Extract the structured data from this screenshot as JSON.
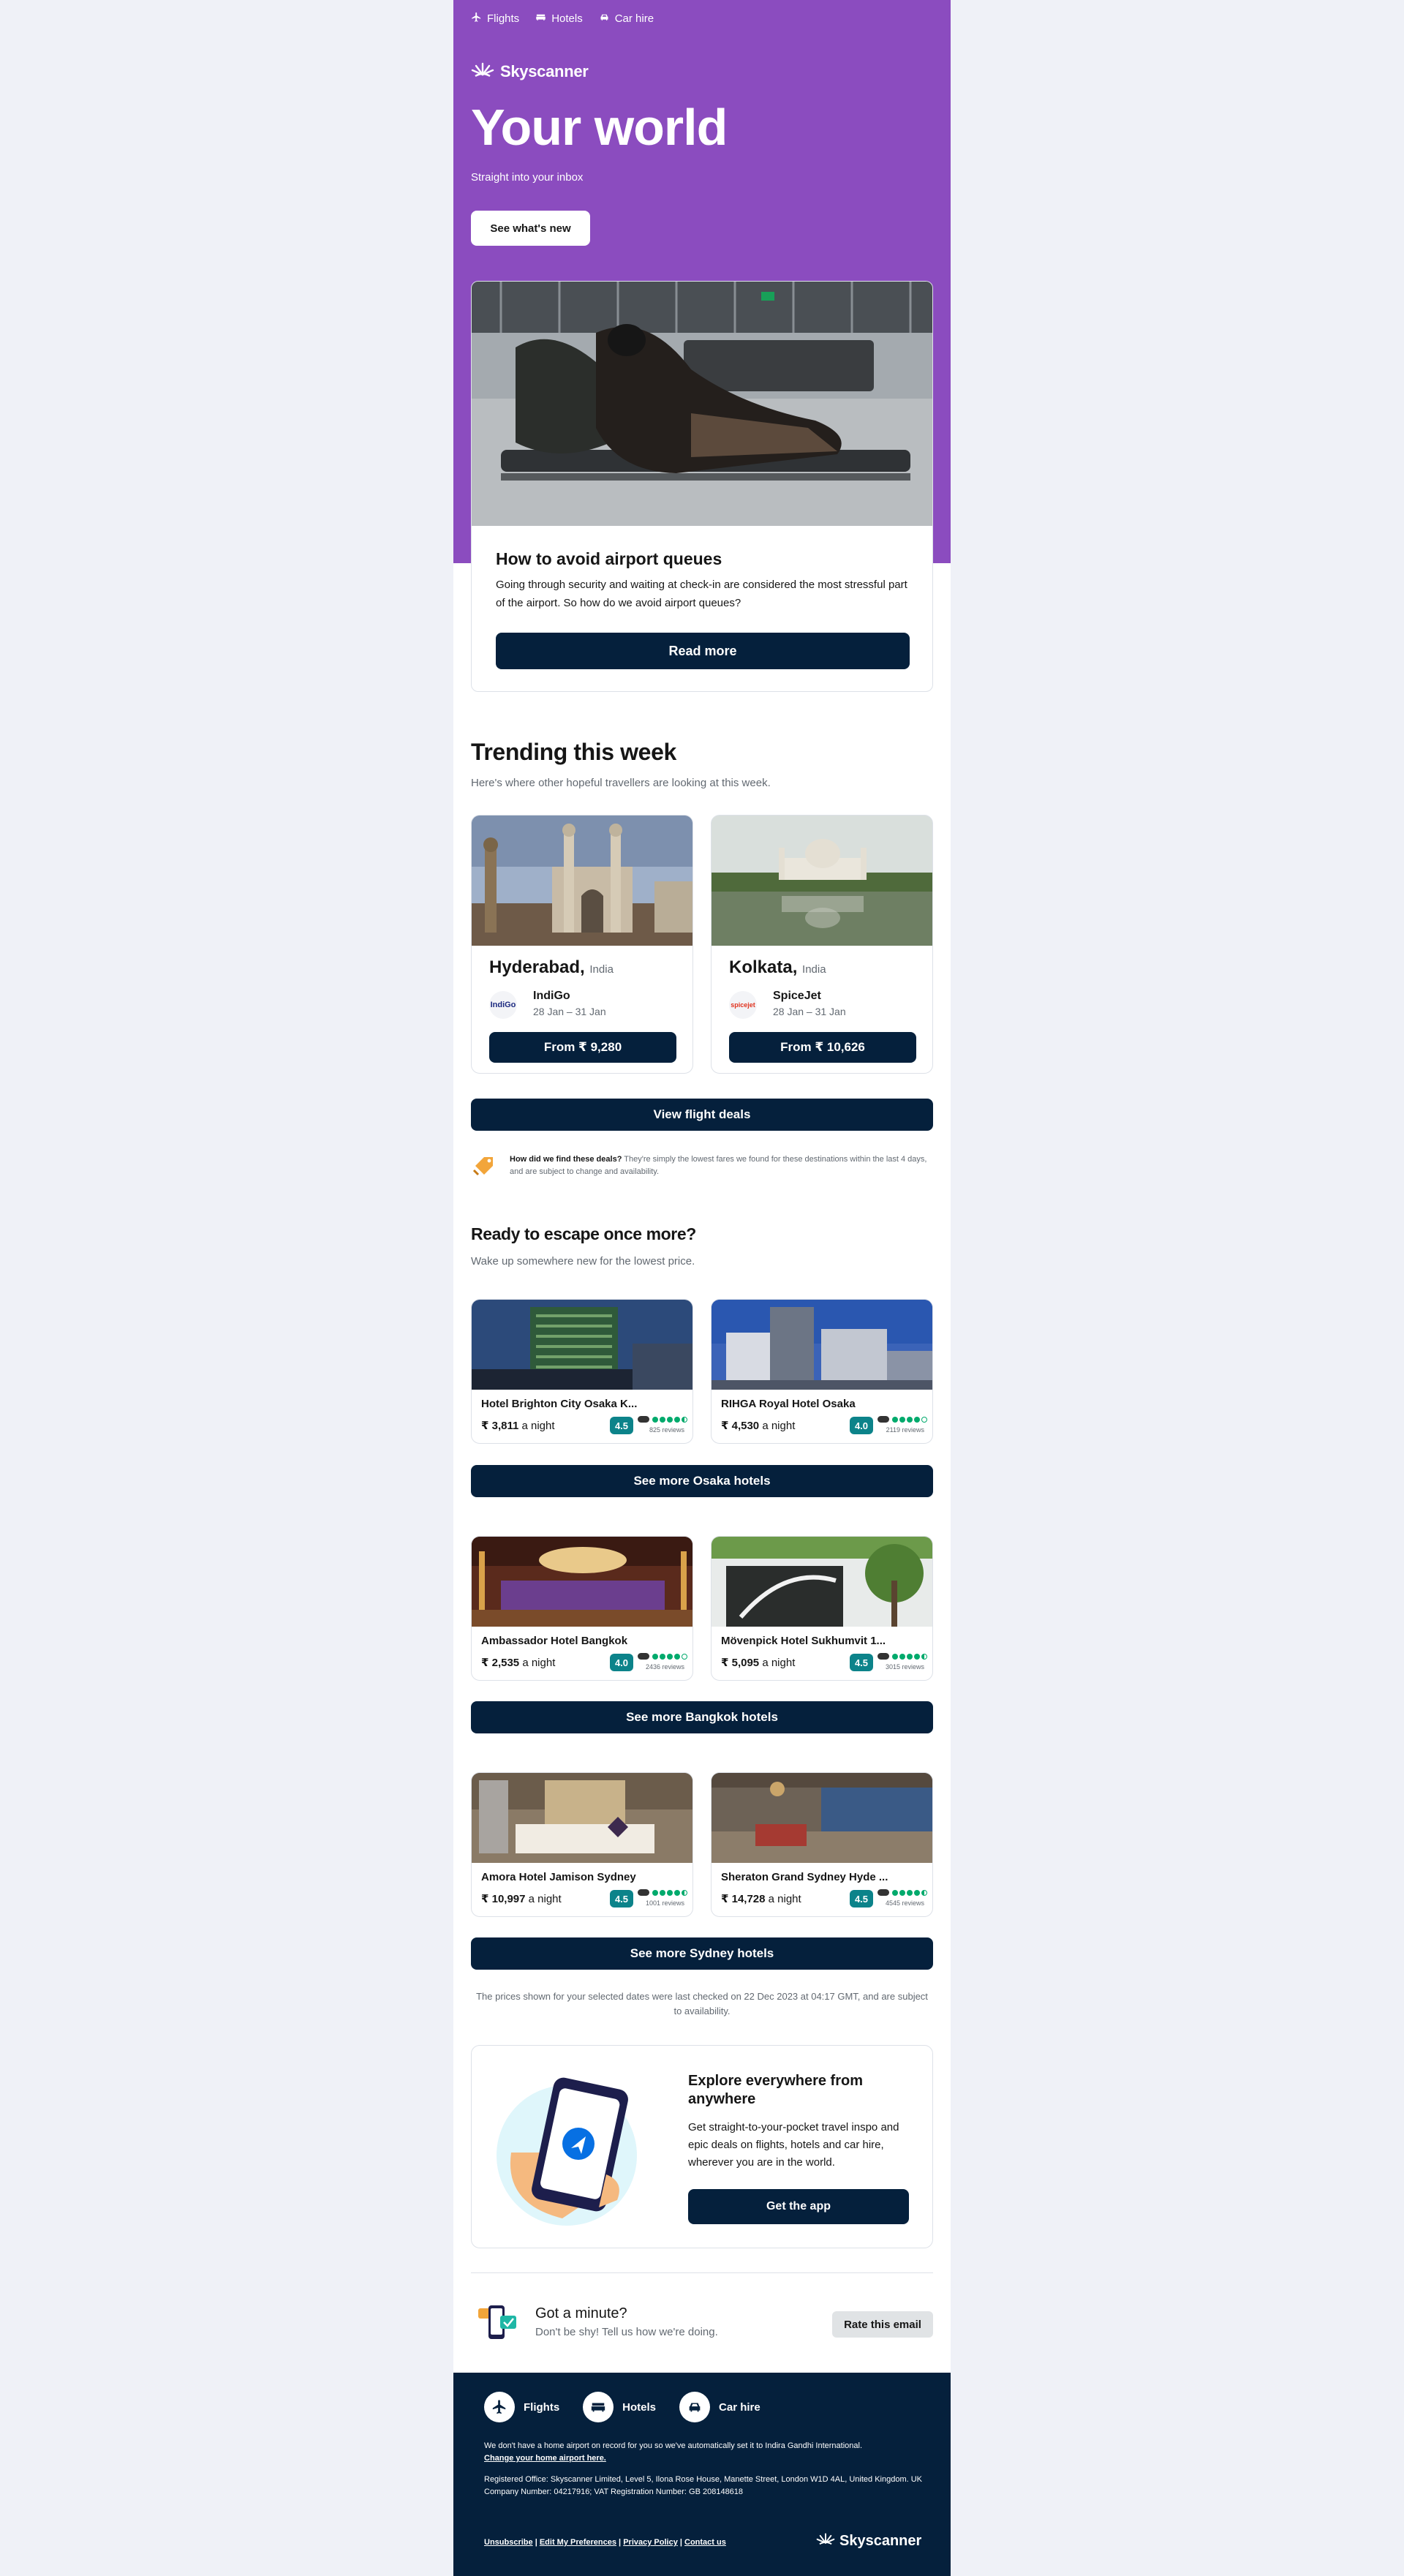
{
  "topnav": {
    "flights": "Flights",
    "hotels": "Hotels",
    "car_hire": "Car hire"
  },
  "brand": "Skyscanner",
  "hero": {
    "title": "Your world",
    "subtitle": "Straight into your inbox",
    "button": "See what's new"
  },
  "article": {
    "title": "How to avoid airport queues",
    "body": "Going through security and waiting at check-in are considered the most stressful part of the airport. So how do we avoid airport queues?",
    "button": "Read more"
  },
  "trending": {
    "title": "Trending this week",
    "subtitle": "Here's where other hopeful travellers are looking at this week.",
    "destinations": [
      {
        "city": "Hyderabad,",
        "country": "India",
        "airline": "IndiGo",
        "airline_logo": "IndiGo",
        "dates": "28 Jan – 31 Jan",
        "price": "From ₹ 9,280"
      },
      {
        "city": "Kolkata,",
        "country": "India",
        "airline": "SpiceJet",
        "airline_logo": "spicejet",
        "dates": "28 Jan – 31 Jan",
        "price": "From ₹ 10,626"
      }
    ],
    "button": "View flight deals",
    "note_bold": "How did we find these deals?",
    "note_text": " They're simply the lowest fares we found for these destinations within the last 4 days, and are subject to change and availability."
  },
  "escape": {
    "title": "Ready to escape once more?",
    "subtitle": "Wake up somewhere new for the lowest price.",
    "groups": [
      {
        "button": "See more Osaka hotels",
        "hotels": [
          {
            "name": "Hotel Brighton City Osaka K...",
            "price": "₹ 3,811",
            "per": " a night",
            "score": "4.5",
            "rating": 4.5,
            "reviews": "825 reviews"
          },
          {
            "name": "RIHGA Royal Hotel Osaka",
            "price": "₹ 4,530",
            "per": " a night",
            "score": "4.0",
            "rating": 4,
            "reviews": "2119 reviews"
          }
        ]
      },
      {
        "button": "See more Bangkok hotels",
        "hotels": [
          {
            "name": "Ambassador Hotel Bangkok",
            "price": "₹ 2,535",
            "per": " a night",
            "score": "4.0",
            "rating": 4,
            "reviews": "2436 reviews"
          },
          {
            "name": "Mövenpick Hotel Sukhumvit 1...",
            "price": "₹ 5,095",
            "per": " a night",
            "score": "4.5",
            "rating": 4.5,
            "reviews": "3015 reviews"
          }
        ]
      },
      {
        "button": "See more Sydney hotels",
        "hotels": [
          {
            "name": "Amora Hotel Jamison Sydney",
            "price": "₹ 10,997",
            "per": " a night",
            "score": "4.5",
            "rating": 4.5,
            "reviews": "1001 reviews"
          },
          {
            "name": "Sheraton Grand Sydney Hyde ...",
            "price": "₹ 14,728",
            "per": " a night",
            "score": "4.5",
            "rating": 4.5,
            "reviews": "4545 reviews"
          }
        ]
      }
    ],
    "disclaimer": "The prices shown for your selected dates were last checked on 22 Dec 2023 at 04:17 GMT, and are subject to availability."
  },
  "app": {
    "title": "Explore everywhere from anywhere",
    "body": "Get straight-to-your-pocket travel inspo and epic deals on flights, hotels and car hire, wherever you are in the world.",
    "button": "Get the app"
  },
  "rate": {
    "title": "Got a minute?",
    "subtitle": "Don't be shy! Tell us how we're doing.",
    "button": "Rate this email"
  },
  "footer": {
    "flights": "Flights",
    "hotels": "Hotels",
    "car_hire": "Car hire",
    "home_airport": "We don't have a home airport on record for you so we've automatically set it to Indira Gandhi International.",
    "home_airport_link": "Change your home airport here.",
    "registered": "Registered Office: Skyscanner Limited, Level 5, Ilona Rose House, Manette Street, London W1D 4AL, United Kingdom. UK Company Number: 04217916; VAT Registration Number: GB 208148618",
    "links": [
      "Unsubscribe",
      "Edit My Preferences",
      "Privacy Policy",
      "Contact us"
    ],
    "brand": "Skyscanner"
  },
  "colors": {
    "hero_purple": "#8b4cbf",
    "navy": "#05203c",
    "score_teal": "#0c838a",
    "tripadvisor_green": "#00aa6c"
  }
}
